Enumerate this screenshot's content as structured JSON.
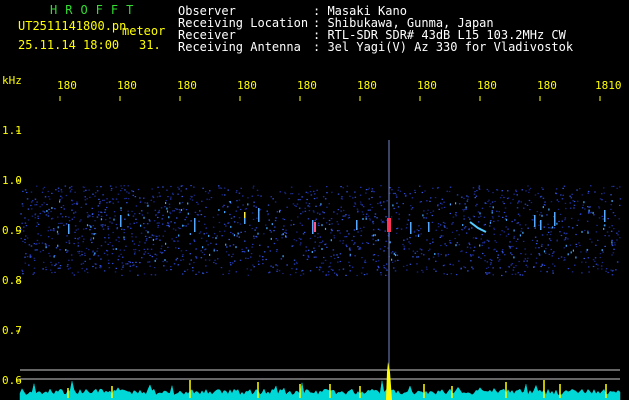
{
  "header": {
    "brand": "HROFFT",
    "filename": "UT2511141800.pn",
    "meteor_label": "meteor",
    "datetime": "25.11.14 18:00",
    "count": "31.",
    "meta": [
      {
        "label": "Observer",
        "value": ": Masaki Kano"
      },
      {
        "label": "Receiving Location",
        "value": ": Shibukawa, Gunma, Japan"
      },
      {
        "label": "Receiver",
        "value": ": RTL-SDR SDR# 43dB L15 103.2MHz CW"
      },
      {
        "label": "Receiving Antenna",
        "value": ": 3el Yagi(V) Az 330 for Vladivostok"
      }
    ]
  },
  "axes": {
    "y_unit": "kHz",
    "y_ticks": [
      "1.1",
      "1.0",
      "0.9",
      "0.8",
      "0.7",
      "0.6"
    ],
    "x_ticks": [
      "180",
      "180",
      "180",
      "180",
      "180",
      "180",
      "180",
      "180",
      "180",
      "1810"
    ]
  },
  "colors": {
    "background": "#000000",
    "header_green": "#33dd33",
    "tick_yellow": "#ffff00",
    "noise_blue": "#2233aa",
    "meteor_red": "#ff3355",
    "spectrum_cyan": "#00d8d8"
  }
}
